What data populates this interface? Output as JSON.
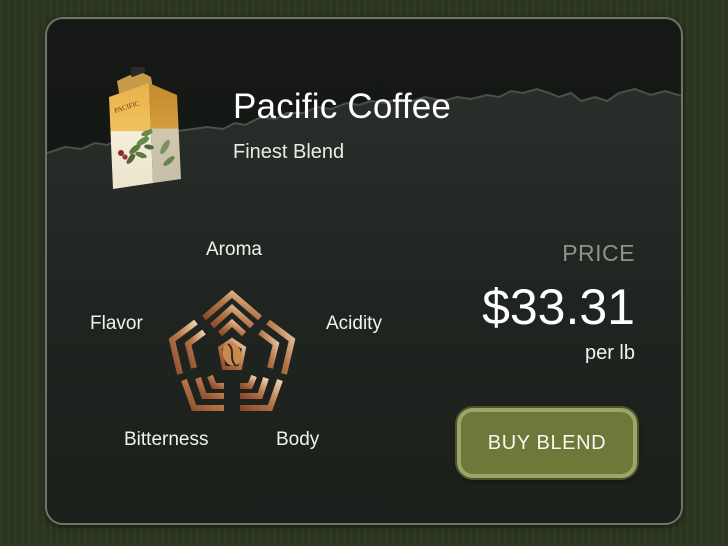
{
  "product": {
    "name": "Pacific Coffee",
    "subtitle": "Finest Blend",
    "bag_brand": "PACIFIC"
  },
  "flavor_profile": {
    "attributes": [
      "Aroma",
      "Acidity",
      "Body",
      "Bitterness",
      "Flavor"
    ]
  },
  "price": {
    "label": "PRICE",
    "value": "$33.31",
    "unit": "per lb"
  },
  "actions": {
    "buy_label": "BUY BLEND"
  },
  "colors": {
    "card_bg": "#151815",
    "page_bg": "#2c3621",
    "button_fill": "#6e7839",
    "button_border": "#9ca56a",
    "muted_text": "#8d928a",
    "icon_gradient_dark": "#8a4a2a",
    "icon_gradient_light": "#e6c49c"
  },
  "icons": [
    "coffee-bag-icon",
    "flavor-pentagon-icon",
    "coffee-bean-icon",
    "mountain-silhouette"
  ]
}
